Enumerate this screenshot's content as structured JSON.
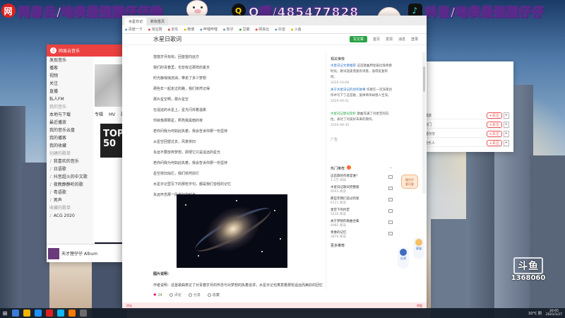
{
  "banners": {
    "left": {
      "logo": "网",
      "text": "网易云/地表最强狸仔仔呦"
    },
    "middle": {
      "logo": "Q",
      "text": "Q群/485477828"
    },
    "right": {
      "logo": "♪",
      "text": "抖音/地表最强狸仔仔"
    }
  },
  "music_app": {
    "title": "网易云音乐",
    "sidebar": [
      {
        "label": "发现音乐",
        "type": "item"
      },
      {
        "label": "播客",
        "type": "item"
      },
      {
        "label": "视频",
        "type": "item"
      },
      {
        "label": "关注",
        "type": "item"
      },
      {
        "label": "直播",
        "type": "item"
      },
      {
        "label": "私人FM",
        "type": "item"
      },
      {
        "label": "我的音乐",
        "type": "group"
      },
      {
        "label": "本地与下载",
        "type": "item"
      },
      {
        "label": "最近播放",
        "type": "item"
      },
      {
        "label": "我的音乐云盘",
        "type": "item"
      },
      {
        "label": "我的播客",
        "type": "item"
      },
      {
        "label": "我的收藏",
        "type": "item"
      },
      {
        "label": "创建的歌单",
        "type": "group"
      },
      {
        "label": "我喜欢的音乐",
        "type": "playlist"
      },
      {
        "label": "日语歌",
        "type": "playlist"
      },
      {
        "label": "抖音超火的中文歌",
        "type": "playlist"
      },
      {
        "label": "夜晚静静听的歌",
        "type": "playlist"
      },
      {
        "label": "粤语歌",
        "type": "playlist"
      },
      {
        "label": "男声",
        "type": "playlist"
      },
      {
        "label": "收藏的歌单",
        "type": "group"
      },
      {
        "label": "ACG 2020",
        "type": "playlist"
      }
    ],
    "tabs": [
      "专辑",
      "MV",
      "歌手"
    ],
    "top_banner": "TOP 50",
    "now_playing": "天才狸仔仔 Album"
  },
  "browser": {
    "tabs": [
      {
        "label": "水星日记",
        "active": true
      },
      {
        "label": "新标签页",
        "active": false
      }
    ],
    "bookmarks": [
      {
        "label": "百度一下",
        "color": "b"
      },
      {
        "label": "淘宝网",
        "color": "r"
      },
      {
        "label": "京东",
        "color": "r"
      },
      {
        "label": "微博",
        "color": "y"
      },
      {
        "label": "哔哩哔哩",
        "color": "b"
      },
      {
        "label": "知乎",
        "color": "b"
      },
      {
        "label": "豆瓣",
        "color": "g"
      },
      {
        "label": "网易云",
        "color": "r"
      },
      {
        "label": "抖音",
        "color": "b"
      },
      {
        "label": "斗鱼",
        "color": "y"
      }
    ],
    "site_title": "水星日歌词",
    "header_right": {
      "button": "写文章",
      "links": [
        "首页",
        "发现",
        "消息",
        "登录"
      ]
    }
  },
  "article": {
    "lines": [
      "悠悠岁月匆匆，回首望向远方",
      "我们的青春里，也曾有过那样的夏天",
      "时光静悄悄流淌，带走了多少梦想",
      "那些年一起走过的路，我们依然记得",
      "那片星空啊，那片星空",
      "在遥远的水星上，星光闪烁着温柔",
      "你就像那颗星，照亮我黑暗的夜",
      "若你问我为何如此执着，我会告诉你那一份坚持",
      "从星空回望过去，风景依旧",
      "永远不要放弃梦想，即便它只是遥远的星光",
      "若你问我为何如此执着，我会告诉你那一份坚持",
      "星空依旧灿烂，我们依然前行",
      "水星日记里写下的那些字句，都是我们曾经的记忆",
      "永远怀念那一段美好的时光"
    ],
    "caption": "图片说明：",
    "paragraph": "作者说明：这首歌曲表达了对青春岁月的怀念与对梦想的执着追求，水星日记也寓意着那些遥远而美好的回忆",
    "actions": {
      "like_count": "24",
      "comment": "评论",
      "share": "分享",
      "collect": "收藏"
    }
  },
  "aside": {
    "section1_title": "相关推荐",
    "related": [
      {
        "title": "水星日记文章推荐",
        "body": "这首歌曲用星辰比喻青春时光，歌词温柔而富有诗意，值得反复聆听。",
        "meta": "2020-10-08"
      },
      {
        "title": "关于水星日记的创作故事",
        "body": "作者在一次深夜创作中写下了这首歌，旋律简单却感人至深。",
        "meta": "2020-09-21"
      },
      {
        "title": "水星日记歌词赏析",
        "body": "歌曲充满了对星空的向往，表达了对美好未来的期许。",
        "meta": "2020-08-30"
      }
    ],
    "ad_label": "广告",
    "hot_title": "热门推荐",
    "hot_items": [
      {
        "title": "这首歌的作者是谁？",
        "meta": "1.2万 阅读"
      },
      {
        "title": "水星日记歌词完整版",
        "meta": "8563 阅读"
      },
      {
        "title": "那些年我们追过的星",
        "meta": "6721 阅读"
      },
      {
        "title": "星空下的约定",
        "meta": "5430 阅读"
      },
      {
        "title": "关于梦想的歌曲合集",
        "meta": "4982 阅读"
      },
      {
        "title": "青春的记忆",
        "meta": "3876 阅读"
      }
    ],
    "footer": "更多推荐"
  },
  "right_panel": {
    "rows": [
      {
        "label": "播放",
        "button": "+关注"
      },
      {
        "label": "热门",
        "button": "+关注"
      },
      {
        "label": "狸仔仔",
        "button": "+关注"
      },
      {
        "label": "音乐人",
        "button": "+关注"
      }
    ]
  },
  "sticker": "狸仔仔\n超可爱",
  "dock": {
    "top": "客服",
    "bottom": "反馈"
  },
  "watermark": {
    "logo": "斗鱼",
    "room": "1368060"
  },
  "taskbar": {
    "weather": "10°C 阴",
    "time": "20:05",
    "date": "2021/1/27"
  },
  "browser_bottom": {
    "left": "评论",
    "right": "举报"
  },
  "colors": {
    "brand_red": "#ec4141",
    "accent_green": "#2ba245",
    "link_blue": "#2a6ec6"
  }
}
